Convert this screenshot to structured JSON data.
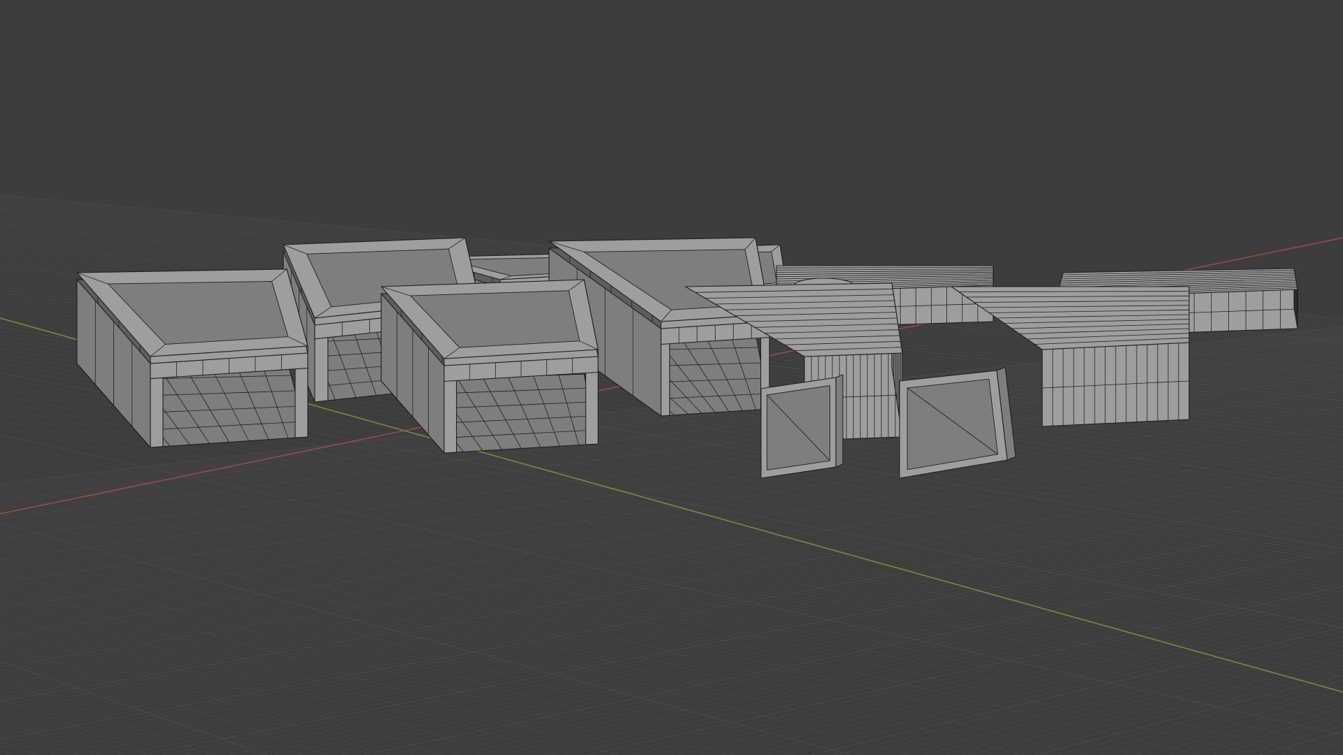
{
  "viewport": {
    "name": "3D Viewport",
    "view": "perspective",
    "shading": "wireframe-overlay",
    "show_grid_floor": true,
    "show_x_axis": true,
    "show_y_axis": true
  },
  "colors": {
    "background": "#3d3d3d",
    "grid_minor": "#4a4a4a",
    "grid_major": "#555555",
    "x_axis": "#9a4a4e",
    "y_axis": "#7a8c3a",
    "mesh_light": "#9e9e9e",
    "mesh_mid": "#7e7e7e",
    "mesh_dark": "#5e5e5e",
    "wire": "#1e1e1e"
  },
  "objects": [
    {
      "id": "module-01",
      "type": "open-frame"
    },
    {
      "id": "module-02",
      "type": "open-frame"
    },
    {
      "id": "module-03",
      "type": "open-frame"
    },
    {
      "id": "module-04",
      "type": "open-frame"
    },
    {
      "id": "module-05",
      "type": "open-frame"
    },
    {
      "id": "module-06",
      "type": "open-frame"
    },
    {
      "id": "module-07",
      "type": "closed-block"
    },
    {
      "id": "module-08",
      "type": "closed-block"
    },
    {
      "id": "module-09",
      "type": "closed-block"
    },
    {
      "id": "module-10",
      "type": "closed-block"
    },
    {
      "id": "cylinder-tank",
      "type": "cylinder"
    },
    {
      "id": "door-panel-left",
      "type": "door-panel"
    },
    {
      "id": "door-panel-right",
      "type": "door-panel"
    }
  ]
}
